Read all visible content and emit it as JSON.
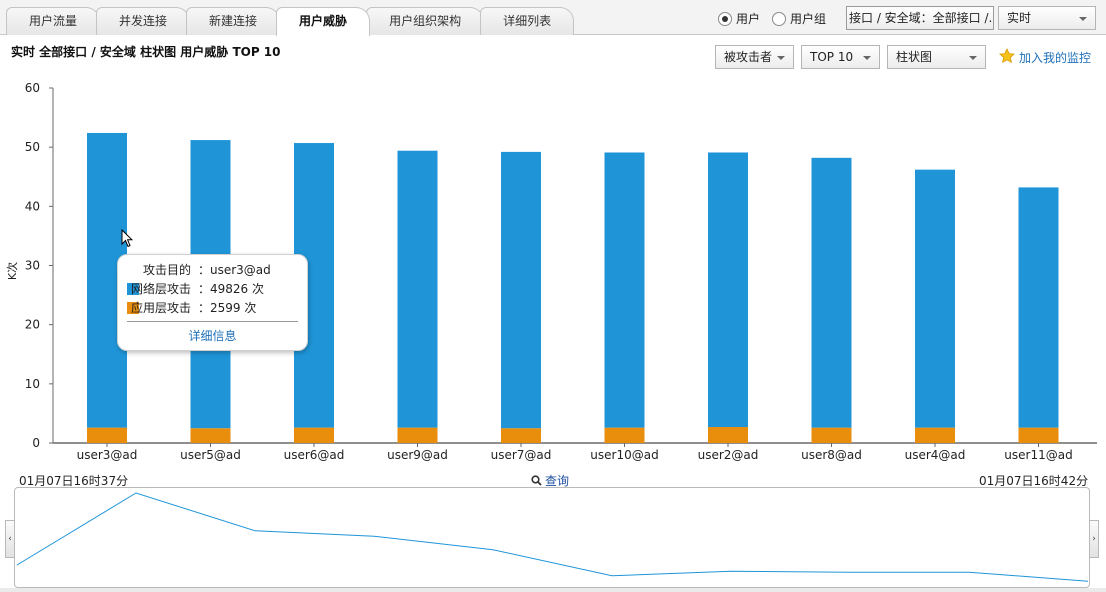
{
  "tabs": [
    {
      "label": "用户流量",
      "active": false
    },
    {
      "label": "并发连接",
      "active": false
    },
    {
      "label": "新建连接",
      "active": false
    },
    {
      "label": "用户威胁",
      "active": true
    },
    {
      "label": "用户组织架构",
      "active": false
    },
    {
      "label": "详细列表",
      "active": false
    }
  ],
  "view_mode": {
    "options": [
      "用户",
      "用户组"
    ],
    "selected": "用户"
  },
  "scope_selector": "接口 / 安全域：全部接口 /...",
  "time_mode": "实时",
  "title": "实时  全部接口 / 安全域  柱状图 用户威胁 TOP 10",
  "filters": {
    "direction": "被攻击者",
    "top": "TOP 10",
    "chart_type": "柱状图"
  },
  "add_monitor_label": "加入我的监控",
  "colors": {
    "network": "#1f95d8",
    "application": "#e98e0c",
    "axis": "#6a6a6a",
    "accent": "#1e6fb8"
  },
  "chart_data": {
    "type": "bar",
    "stacked": true,
    "categories": [
      "user3@ad",
      "user5@ad",
      "user6@ad",
      "user9@ad",
      "user7@ad",
      "user10@ad",
      "user2@ad",
      "user8@ad",
      "user4@ad",
      "user11@ad"
    ],
    "series": [
      {
        "name": "网络层攻击",
        "values": [
          49.8,
          48.7,
          48.1,
          46.8,
          46.7,
          46.5,
          46.4,
          45.6,
          43.6,
          40.6
        ]
      },
      {
        "name": "应用层攻击",
        "values": [
          2.6,
          2.5,
          2.6,
          2.6,
          2.5,
          2.6,
          2.7,
          2.6,
          2.6,
          2.6
        ]
      }
    ],
    "ylabel": "K次",
    "ylim": [
      0,
      60
    ],
    "yticks": [
      0,
      10,
      20,
      30,
      40,
      50,
      60
    ],
    "grid": false
  },
  "tooltip": {
    "target_label": "攻击目的",
    "target_value": "：user3@ad",
    "network_label": "网络层攻击",
    "network_value": "：49826 次",
    "app_label": "应用层攻击",
    "app_value": "：2599 次",
    "detail_link": "详细信息"
  },
  "time_range": {
    "start": "01月07日16时37分",
    "end": "01月07日16时42分"
  },
  "query_label": "查询",
  "overview": {
    "values": [
      0.2,
      1.0,
      0.58,
      0.52,
      0.37,
      0.08,
      0.13,
      0.12,
      0.12,
      0.02
    ]
  }
}
